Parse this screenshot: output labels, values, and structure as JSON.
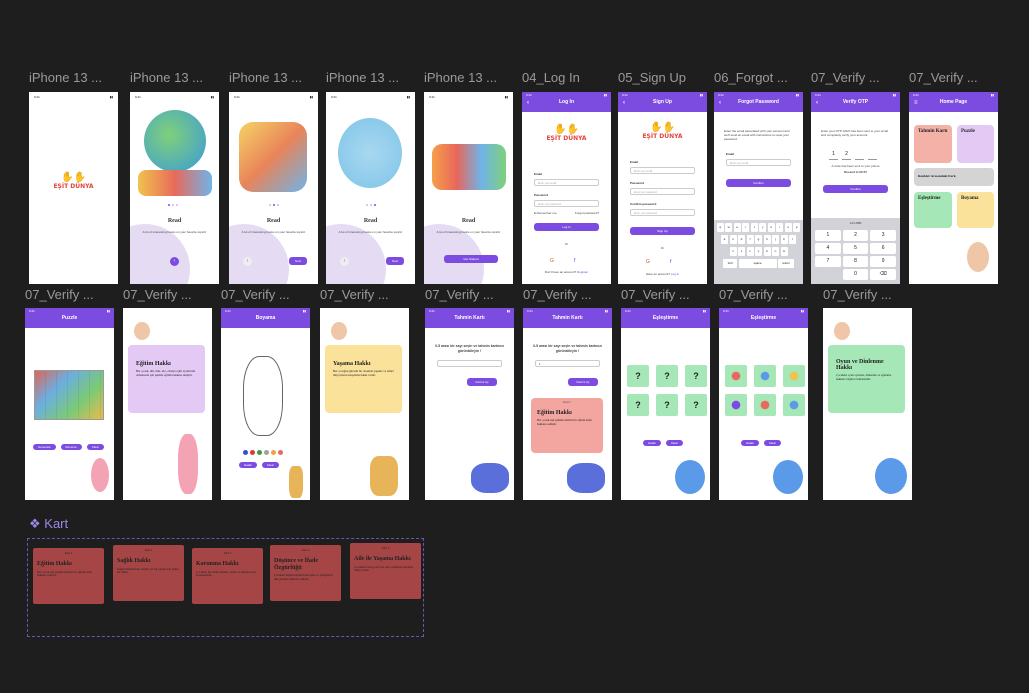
{
  "frame_labels_row1": [
    "iPhone 13 ...",
    "iPhone 13 ...",
    "iPhone 13 ...",
    "iPhone 13 ...",
    "iPhone 13 ...",
    "04_Log In",
    "05_Sign Up",
    "06_Forgot ...",
    "07_Verify ...",
    "07_Verify ..."
  ],
  "frame_labels_row2": [
    "07_Verify ...",
    "07_Verify ...",
    "07_Verify ...",
    "07_Verify ...",
    "07_Verify ...",
    "07_Verify ...",
    "07_Verify ...",
    "07_Verify ...",
    "07_Verify ..."
  ],
  "status_time": "9:41",
  "logo_text": "EŞİT DÜNYA",
  "onboarding": {
    "title": "Read",
    "subtitle": "A lot of interesting books on your favorite topics!",
    "next": "Next",
    "get_started": "Get Started"
  },
  "login": {
    "title": "Log In",
    "email_label": "Email",
    "email_placeholder": "Enter your email",
    "password_label": "Password",
    "password_placeholder": "Enter your password",
    "remember": "Remember me",
    "forgot": "Forgot password?",
    "button": "Log In",
    "or": "Or",
    "footer": "Don't have an account?",
    "footer_link": "Register"
  },
  "signup": {
    "title": "Sign Up",
    "email_label": "Email",
    "email_placeholder": "Enter your email",
    "password_label": "Password",
    "password_placeholder": "Enter your password",
    "confirm_label": "Confirm password",
    "confirm_placeholder": "Enter your password",
    "button": "Sign Up",
    "or": "Or",
    "footer": "Have an account?",
    "footer_link": "Log In"
  },
  "forgot": {
    "title": "Forgot Password",
    "text": "Enter the email associated with your account and we'll send an email with instructions to reset your password.",
    "email_label": "Email",
    "email_placeholder": "Enter your email",
    "button": "Confirm",
    "keys_row1": [
      "q",
      "w",
      "e",
      "r",
      "t",
      "y",
      "u",
      "i",
      "o",
      "p"
    ],
    "keys_row2": [
      "a",
      "s",
      "d",
      "f",
      "g",
      "h",
      "j",
      "k",
      "l"
    ],
    "keys_row3": [
      "z",
      "x",
      "c",
      "v",
      "b",
      "n",
      "m"
    ],
    "space": "space",
    "return": "return",
    "num": "123"
  },
  "verify": {
    "title": "Verify OTP",
    "text": "Enter your OTP which has been sent to your email and completely verify your account.",
    "digits": [
      "1",
      "2",
      "",
      ""
    ],
    "resend_text": "A code has been sent to your phone",
    "resend": "Resend in 00:57",
    "button": "Confirm",
    "numpad": [
      "1",
      "2",
      "3",
      "4",
      "5",
      "6",
      "7",
      "8",
      "9",
      "",
      "0",
      "⌫"
    ],
    "numpad_sub": "123 ABB"
  },
  "home": {
    "title": "Home Page",
    "tiles": [
      "Tahmin Kartı",
      "Puzzle",
      "Renkler Arasındaki Fark",
      "Eşleştirme",
      "Boyama"
    ]
  },
  "puzzle": {
    "title": "Puzzle",
    "buttons": [
      "Generate",
      "Reverse",
      "Clear"
    ]
  },
  "egitim": {
    "title": "Eğitim Hakkı",
    "text": "Her çocuk, dili, dini, ırkı, cinsiyet gibi ayrımcılık olmaksızın eşit şekilde eğitim hakkına sahiptir."
  },
  "boyama": {
    "title": "Boyama",
    "buttons": [
      "Hatalı",
      "Clear"
    ]
  },
  "yasama": {
    "title": "Yaşama Hakkı",
    "text": "Her çocuğun güvenli bir ortamda yaşama ve temel ihtiyaçlarını karşılama hakkı vardır."
  },
  "tahmin": {
    "title": "Tahmin Kartı",
    "question": "0-5 arası bir sayı seçin ve tahmin kartınızı görüntüleyin !",
    "button": "Kartını Aç",
    "input_value": "1",
    "card_label": "Kart 1",
    "card_title": "Eğitim Hakkı",
    "card_text": "Her çocuk eşit şekilde kaliteli bir eğitim alma hakkına sahiptir."
  },
  "esles": {
    "title": "Eşleştirme",
    "q": "?",
    "buttons": [
      "Hatalı",
      "Clear"
    ]
  },
  "oyun": {
    "title": "Oyun ve Dinlenme Hakkı",
    "text": "Çocuklar oyun oynama, dinlenme ve eğlenme hakkına özgürce kullanabilir."
  },
  "kart_section": {
    "label": "Kart",
    "cards": [
      {
        "label": "Kart 1",
        "title": "Eğitim Hakkı",
        "text": "Her çocuk eşit şekilde kaliteli bir eğitim alma hakkına sahiptir."
      },
      {
        "label": "Kart 2",
        "title": "Sağlık Hakkı",
        "text": "Sağlık hizmetlerine erişim, iyi bir yaşam için temel bir haktır."
      },
      {
        "label": "Kart 3",
        "title": "Korunma Hakkı",
        "text": "Çocuklar her türlü istismar, şiddet ve ihmale karşı korunmalıdır."
      },
      {
        "label": "Kart 4",
        "title": "Düşünce ve İfade Özgürlüğü",
        "text": "Çocuklar düşüncelerini ifade etme ve görüşlerini dile getirme hakkına sahiptir."
      },
      {
        "label": "Kart 5",
        "title": "Aile ile Yaşama Hakkı",
        "text": "Çocukların sevgi dolu bir aile ortamında büyüme hakkı vardır."
      }
    ]
  },
  "colors": {
    "accent": "#7c4ce0",
    "background": "#1e1e1e",
    "card_red": "#a64545"
  }
}
